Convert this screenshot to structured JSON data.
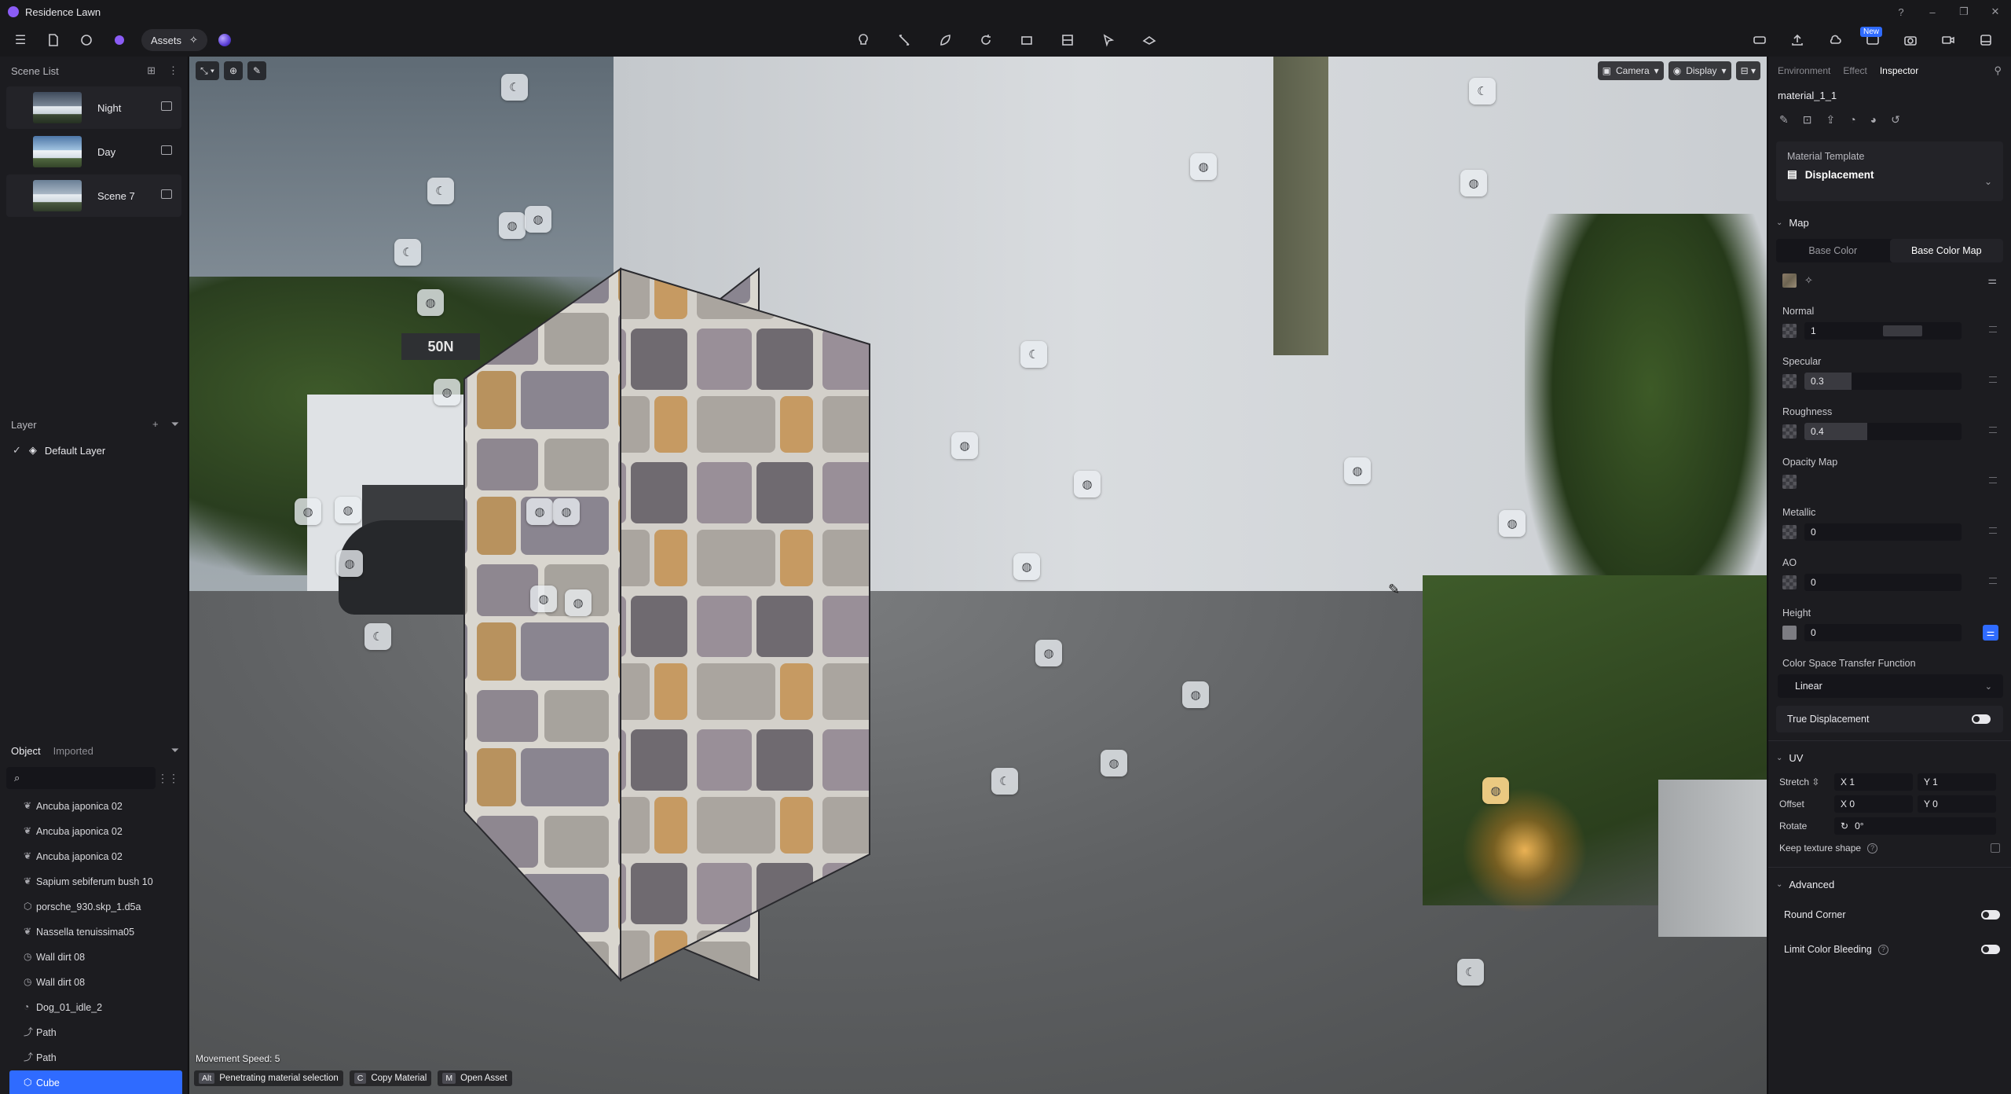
{
  "window": {
    "title": "Residence Lawn"
  },
  "toolbar": {
    "assets_label": "Assets",
    "new_badge": "New"
  },
  "scene_list": {
    "title": "Scene List",
    "items": [
      {
        "label": "Night"
      },
      {
        "label": "Day"
      },
      {
        "label": "Scene 7"
      }
    ]
  },
  "layer": {
    "title": "Layer",
    "items": [
      {
        "label": "Default Layer"
      }
    ]
  },
  "objects": {
    "tabs": [
      "Object",
      "Imported"
    ],
    "search_placeholder": "",
    "items": [
      {
        "label": "Ancuba japonica 02",
        "icon": "plant-icon"
      },
      {
        "label": "Ancuba japonica 02",
        "icon": "plant-icon"
      },
      {
        "label": "Ancuba japonica 02",
        "icon": "plant-icon"
      },
      {
        "label": "Sapium sebiferum bush 10",
        "icon": "plant-icon"
      },
      {
        "label": "porsche_930.skp_1.d5a",
        "icon": "model-icon"
      },
      {
        "label": "Nassella tenuissima05",
        "icon": "plant-icon"
      },
      {
        "label": "Wall dirt 08",
        "icon": "decal-icon"
      },
      {
        "label": "Wall dirt 08",
        "icon": "decal-icon"
      },
      {
        "label": "Dog_01_idle_2",
        "icon": "animal-icon"
      },
      {
        "label": "Path",
        "icon": "path-icon"
      },
      {
        "label": "Path",
        "icon": "path-icon"
      },
      {
        "label": "Cube",
        "icon": "cube-icon",
        "selected": true
      }
    ]
  },
  "viewport": {
    "camera_label": "Camera",
    "display_label": "Display",
    "sign_text": "50N",
    "movement_speed": "Movement Speed: 5",
    "hints": [
      {
        "key": "Alt",
        "label": "Penetrating material selection"
      },
      {
        "key": "C",
        "label": "Copy Material"
      },
      {
        "key": "M",
        "label": "Open Asset"
      }
    ]
  },
  "inspector": {
    "tabs": [
      "Environment",
      "Effect",
      "Inspector"
    ],
    "active_tab": "Inspector",
    "material_name": "material_1_1",
    "template_label": "Material Template",
    "template_value": "Displacement",
    "map_section": "Map",
    "base_tabs": [
      "Base Color",
      "Base Color Map"
    ],
    "normal": {
      "label": "Normal",
      "value": "1"
    },
    "specular": {
      "label": "Specular",
      "value": "0.3",
      "fill": 0.3
    },
    "roughness": {
      "label": "Roughness",
      "value": "0.4",
      "fill": 0.4
    },
    "opacity_map": {
      "label": "Opacity Map"
    },
    "metallic": {
      "label": "Metallic",
      "value": "0"
    },
    "ao": {
      "label": "AO",
      "value": "0"
    },
    "height": {
      "label": "Height",
      "value": "0"
    },
    "color_space": {
      "label": "Color Space Transfer Function",
      "value": "Linear"
    },
    "true_displacement": {
      "label": "True Displacement",
      "on": false
    },
    "uv": {
      "title": "UV",
      "stretch_label": "Stretch",
      "stretch_x": "X 1",
      "stretch_y": "Y 1",
      "offset_label": "Offset",
      "offset_x": "X 0",
      "offset_y": "Y 0",
      "rotate_label": "Rotate",
      "rotate_value": "0°",
      "keep_texture_label": "Keep texture shape"
    },
    "advanced": {
      "title": "Advanced",
      "round_corner": "Round Corner",
      "limit_color_bleeding": "Limit Color Bleeding"
    }
  },
  "colors": {
    "accent": "#2f6bff",
    "panel": "#1c1c20",
    "app_logo": "#8b5cf6"
  }
}
